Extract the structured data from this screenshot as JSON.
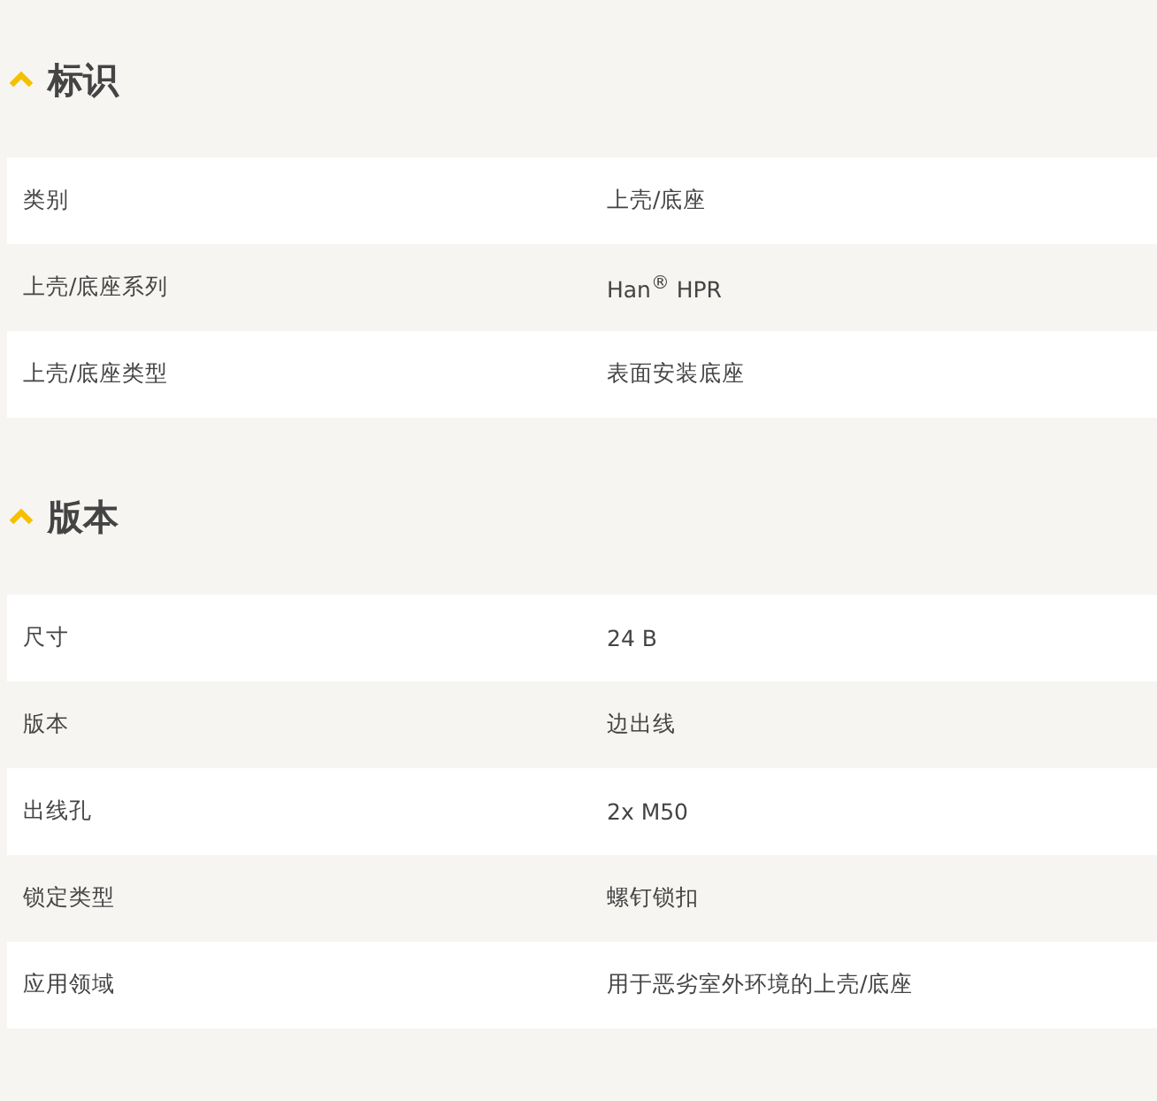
{
  "sections": [
    {
      "title": "标识",
      "expanded": true,
      "rows": [
        {
          "label": "类别",
          "value": "上壳/底座"
        },
        {
          "label": "上壳/底座系列",
          "value": "Han$^{®}$ HPR"
        },
        {
          "label": "上壳/底座类型",
          "value": "表面安装底座"
        }
      ]
    },
    {
      "title": "版本",
      "expanded": true,
      "rows": [
        {
          "label": "尺寸",
          "value": "24 B"
        },
        {
          "label": "版本",
          "value": "边出线"
        },
        {
          "label": "出线孔",
          "value": "2x M50"
        },
        {
          "label": "锁定类型",
          "value": "螺钉锁扣"
        },
        {
          "label": "应用领域",
          "value": "用于恶劣室外环境的上壳/底座"
        }
      ]
    }
  ]
}
